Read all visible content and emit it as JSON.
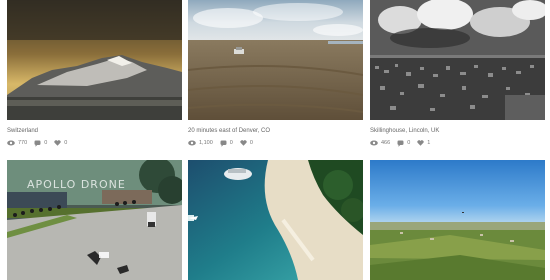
{
  "cards": [
    {
      "caption": "Switzerland",
      "views": "770",
      "comments": "0",
      "likes": "0"
    },
    {
      "caption": "20 minutes east of Denver, CO",
      "views": "1,100",
      "comments": "0",
      "likes": "0"
    },
    {
      "caption": "Skillinghouse, Lincoln, UK",
      "views": "466",
      "comments": "0",
      "likes": "1"
    },
    {
      "caption": "",
      "overlay": "APOLLO DRONE"
    },
    {
      "caption": ""
    },
    {
      "caption": ""
    }
  ],
  "icons": {
    "views": "eye-icon",
    "comments": "comment-icon",
    "likes": "heart-icon"
  }
}
